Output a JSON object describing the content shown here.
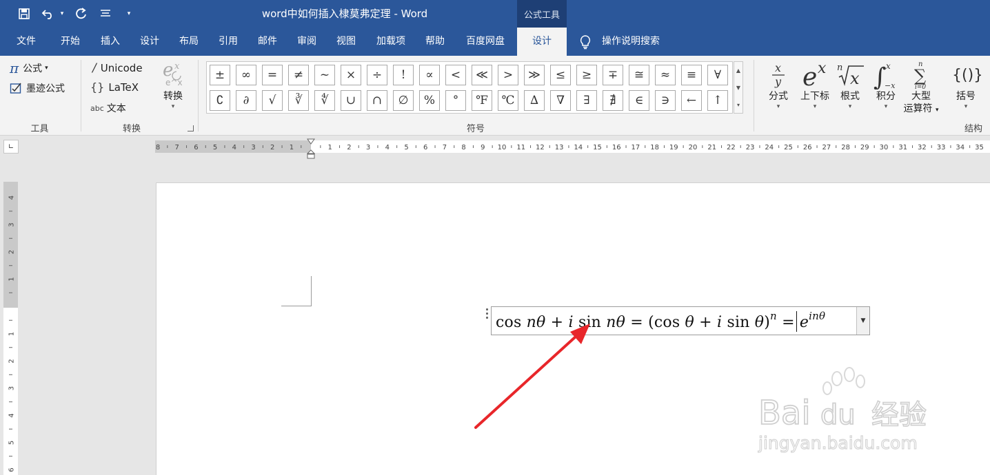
{
  "window": {
    "title": "word中如何插入棣莫弗定理 - Word",
    "context_tab_header": "公式工具"
  },
  "tabs": [
    {
      "label": "文件"
    },
    {
      "label": "开始"
    },
    {
      "label": "插入"
    },
    {
      "label": "设计"
    },
    {
      "label": "布局"
    },
    {
      "label": "引用"
    },
    {
      "label": "邮件"
    },
    {
      "label": "审阅"
    },
    {
      "label": "视图"
    },
    {
      "label": "加载项"
    },
    {
      "label": "帮助"
    },
    {
      "label": "百度网盘"
    },
    {
      "label": "设计",
      "active": true
    }
  ],
  "tell_me": {
    "label": "操作说明搜索"
  },
  "ribbon": {
    "tools": {
      "equation_label": "公式",
      "ink_equation_label": "墨迹公式",
      "group_label": "工具"
    },
    "conversions": {
      "unicode_label": "Unicode",
      "latex_label": "LaTeX",
      "text_prefix": "abc",
      "text_label": "文本",
      "convert_label": "转换",
      "group_label": "转换"
    },
    "symbols": {
      "group_label": "符号",
      "row1": [
        "±",
        "∞",
        "=",
        "≠",
        "~",
        "×",
        "÷",
        "!",
        "∝",
        "<",
        "≪",
        ">",
        "≫",
        "≤",
        "≥",
        "∓",
        "≅",
        "≈",
        "≡",
        "∀"
      ],
      "row2": [
        "∁",
        "∂",
        "√",
        "∛",
        "∜",
        "∪",
        "∩",
        "∅",
        "%",
        "°",
        "℉",
        "℃",
        "∆",
        "∇",
        "∃",
        "∄",
        "∈",
        "∋",
        "←",
        "↑"
      ]
    },
    "structures": {
      "group_label": "结构",
      "buttons": [
        {
          "label": "分式"
        },
        {
          "label": "上下标"
        },
        {
          "label": "根式"
        },
        {
          "label": "积分"
        },
        {
          "label": "大型",
          "label2": "运算符"
        },
        {
          "label": "括号"
        }
      ]
    }
  },
  "hruler": {
    "left_numbers": [
      "8",
      "7",
      "6",
      "5",
      "4",
      "3",
      "2",
      "1"
    ],
    "right_numbers": [
      "1",
      "2",
      "3",
      "4",
      "5",
      "6",
      "7",
      "8",
      "9",
      "10",
      "11",
      "12",
      "13",
      "14",
      "15",
      "16",
      "17",
      "18",
      "19",
      "20",
      "21",
      "22",
      "23",
      "24",
      "25",
      "26",
      "27",
      "28",
      "29",
      "30",
      "31",
      "32",
      "33",
      "34",
      "35"
    ]
  },
  "vruler": {
    "top_numbers": [
      "4",
      "3",
      "2",
      "1"
    ],
    "bottom_numbers": [
      "1",
      "2",
      "3",
      "4",
      "5",
      "6"
    ]
  },
  "equation": {
    "p1": "cos ",
    "n1": "n",
    "t1": "θ",
    "op1": " + ",
    "i1": "i",
    "p2": " sin ",
    "n2": "n",
    "t2": "θ",
    "op2": " = (cos ",
    "t3": "θ",
    "op3": " + ",
    "i2": "i",
    "p3": " sin ",
    "t4": "θ",
    "p4": ")",
    "exp1": "n",
    "op4": " = ",
    "e": "e",
    "exp2": "inθ"
  },
  "watermark": {
    "brand": "Bai",
    "brand_tail": "du",
    "cn": "经验",
    "url": "jingyan.baidu.com"
  },
  "colors": {
    "titlebar": "#2b579a",
    "annotation_arrow": "#e8262a"
  }
}
